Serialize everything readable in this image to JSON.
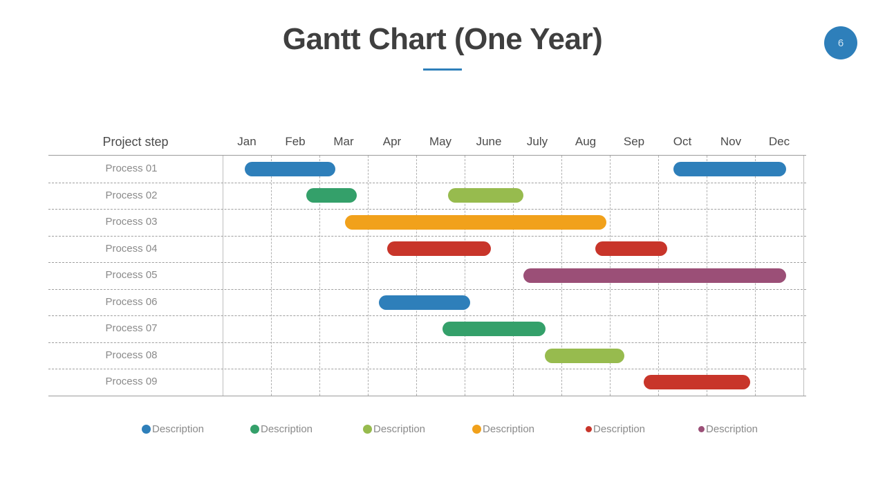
{
  "slide": {
    "title": "Gantt Chart (One Year)",
    "page_number": "6",
    "accent_color": "#2e7fba"
  },
  "chart_data": {
    "type": "bar",
    "subtype": "gantt",
    "title": "Gantt Chart (One Year)",
    "xlabel": "",
    "ylabel": "Project step",
    "row_header": "Project step",
    "categories": [
      "Jan",
      "Feb",
      "Mar",
      "Apr",
      "May",
      "June",
      "July",
      "Aug",
      "Sep",
      "Oct",
      "Nov",
      "Dec"
    ],
    "xlim": [
      0,
      12
    ],
    "grid": true,
    "legend_position": "bottom",
    "palette": {
      "blue": "#2e7fba",
      "green": "#34a06a",
      "yellow_green": "#97bb4e",
      "orange": "#f1a11b",
      "red": "#c8352a",
      "purple": "#9b4f77"
    },
    "rows": [
      {
        "label": "Process 01",
        "bars": [
          {
            "start": 0.45,
            "end": 2.33,
            "color": "#2e7fba"
          },
          {
            "start": 9.31,
            "end": 11.64,
            "color": "#2e7fba"
          }
        ]
      },
      {
        "label": "Process 02",
        "bars": [
          {
            "start": 1.73,
            "end": 2.77,
            "color": "#34a06a"
          },
          {
            "start": 4.66,
            "end": 6.21,
            "color": "#97bb4e"
          }
        ]
      },
      {
        "label": "Process 03",
        "bars": [
          {
            "start": 2.53,
            "end": 7.93,
            "color": "#f1a11b"
          }
        ]
      },
      {
        "label": "Process 04",
        "bars": [
          {
            "start": 3.4,
            "end": 5.54,
            "color": "#c8352a"
          },
          {
            "start": 7.7,
            "end": 9.19,
            "color": "#c8352a"
          }
        ]
      },
      {
        "label": "Process 05",
        "bars": [
          {
            "start": 6.21,
            "end": 11.64,
            "color": "#9b4f77"
          }
        ]
      },
      {
        "label": "Process 06",
        "bars": [
          {
            "start": 3.23,
            "end": 5.11,
            "color": "#2e7fba"
          }
        ]
      },
      {
        "label": "Process 07",
        "bars": [
          {
            "start": 4.54,
            "end": 6.67,
            "color": "#34a06a"
          }
        ]
      },
      {
        "label": "Process 08",
        "bars": [
          {
            "start": 6.66,
            "end": 8.3,
            "color": "#97bb4e"
          }
        ]
      },
      {
        "label": "Process 09",
        "bars": [
          {
            "start": 8.7,
            "end": 10.9,
            "color": "#c8352a"
          }
        ]
      }
    ],
    "legend": [
      {
        "label": "Description",
        "color": "#2e7fba",
        "size": 13
      },
      {
        "label": "Description",
        "color": "#34a06a",
        "size": 13
      },
      {
        "label": "Description",
        "color": "#97bb4e",
        "size": 13
      },
      {
        "label": "Description",
        "color": "#f1a11b",
        "size": 13
      },
      {
        "label": "Description",
        "color": "#c8352a",
        "size": 9
      },
      {
        "label": "Description",
        "color": "#9b4f77",
        "size": 9
      }
    ]
  }
}
